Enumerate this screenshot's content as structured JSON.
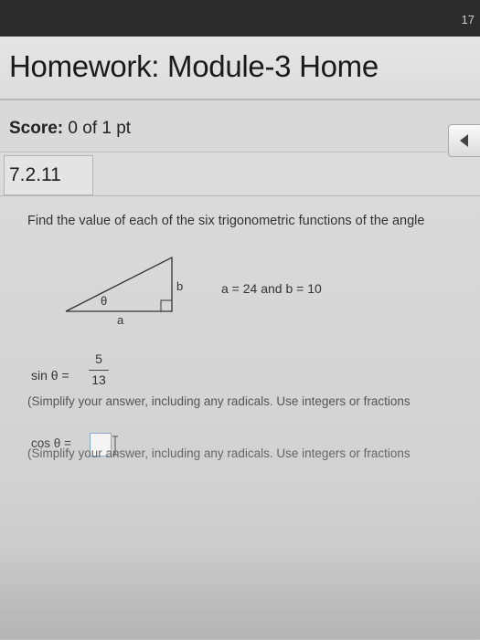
{
  "page_number": "17",
  "header": {
    "title": "Homework: Module-3 Home"
  },
  "score": {
    "label": "Score:",
    "value": "0 of 1 pt"
  },
  "question": {
    "number": "7.2.11",
    "instruction": "Find the value of each of the six trigonometric functions of the angle",
    "triangle": {
      "side_b": "b",
      "side_a": "a",
      "angle": "θ"
    },
    "given": "a = 24  and  b = 10",
    "sin_label": "sin θ =",
    "sin_numerator": "5",
    "sin_denominator": "13",
    "hint_1": "(Simplify your answer, including any radicals. Use integers or fractions",
    "cos_label": "cos θ =",
    "cos_value": "",
    "hint_2": "(Simplify your answer, including any radicals. Use integers or fractions"
  },
  "colors": {
    "topbar": "#2b2b2b",
    "background": "#d8d8d8",
    "input_border": "#8aa9c9"
  }
}
